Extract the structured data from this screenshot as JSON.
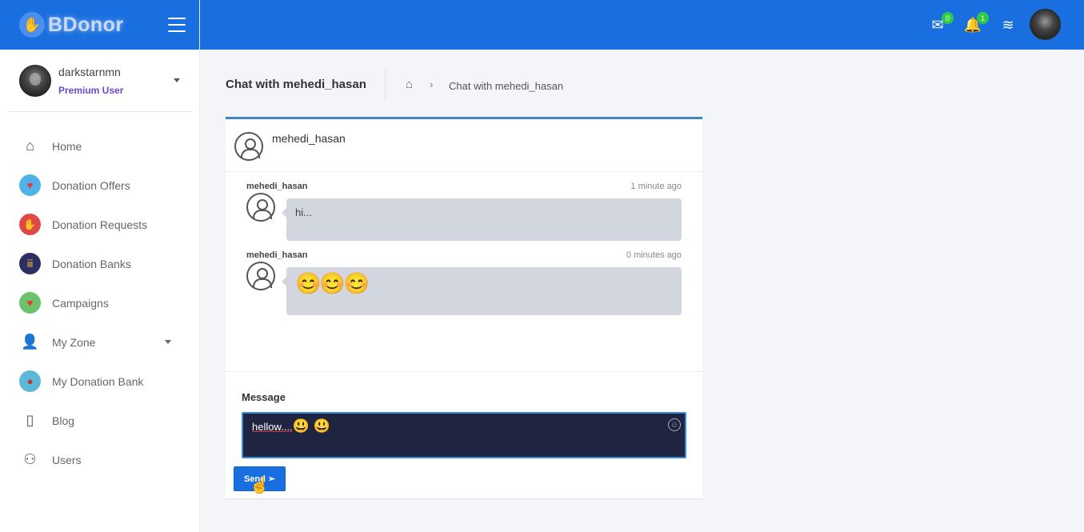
{
  "brand": {
    "name": "BDonor"
  },
  "user": {
    "name": "darkstarnmn",
    "role": "Premium User"
  },
  "nav": [
    {
      "label": "Home",
      "icon": "home-icon"
    },
    {
      "label": "Donation Offers",
      "icon": "heart-hand-icon"
    },
    {
      "label": "Donation Requests",
      "icon": "raised-hand-icon"
    },
    {
      "label": "Donation Banks",
      "icon": "group-icon"
    },
    {
      "label": "Campaigns",
      "icon": "campaign-icon"
    },
    {
      "label": "My Zone",
      "icon": "person-icon"
    },
    {
      "label": "My Donation Bank",
      "icon": "bank-icon"
    },
    {
      "label": "Blog",
      "icon": "notebook-icon"
    },
    {
      "label": "Users",
      "icon": "users-icon"
    }
  ],
  "topbar": {
    "mail_count": "0",
    "notification_count": "1"
  },
  "page": {
    "title": "Chat with mehedi_hasan",
    "breadcrumb_current": "Chat with mehedi_hasan"
  },
  "chat": {
    "partner": "mehedi_hasan",
    "messages": [
      {
        "author": "mehedi_hasan",
        "time": "1 minute ago",
        "text": "hi..."
      },
      {
        "author": "mehedi_hasan",
        "time": "0 minutes ago",
        "text": "😊😊😊"
      }
    ],
    "compose": {
      "label": "Message",
      "value": "hellow....",
      "value_emojis": "😃 😃",
      "send_label": "Send"
    }
  },
  "colors": {
    "primary": "#1a6fe0",
    "premium": "#6a48c9",
    "badge": "#2ecc40",
    "input_bg": "#1f2441"
  }
}
